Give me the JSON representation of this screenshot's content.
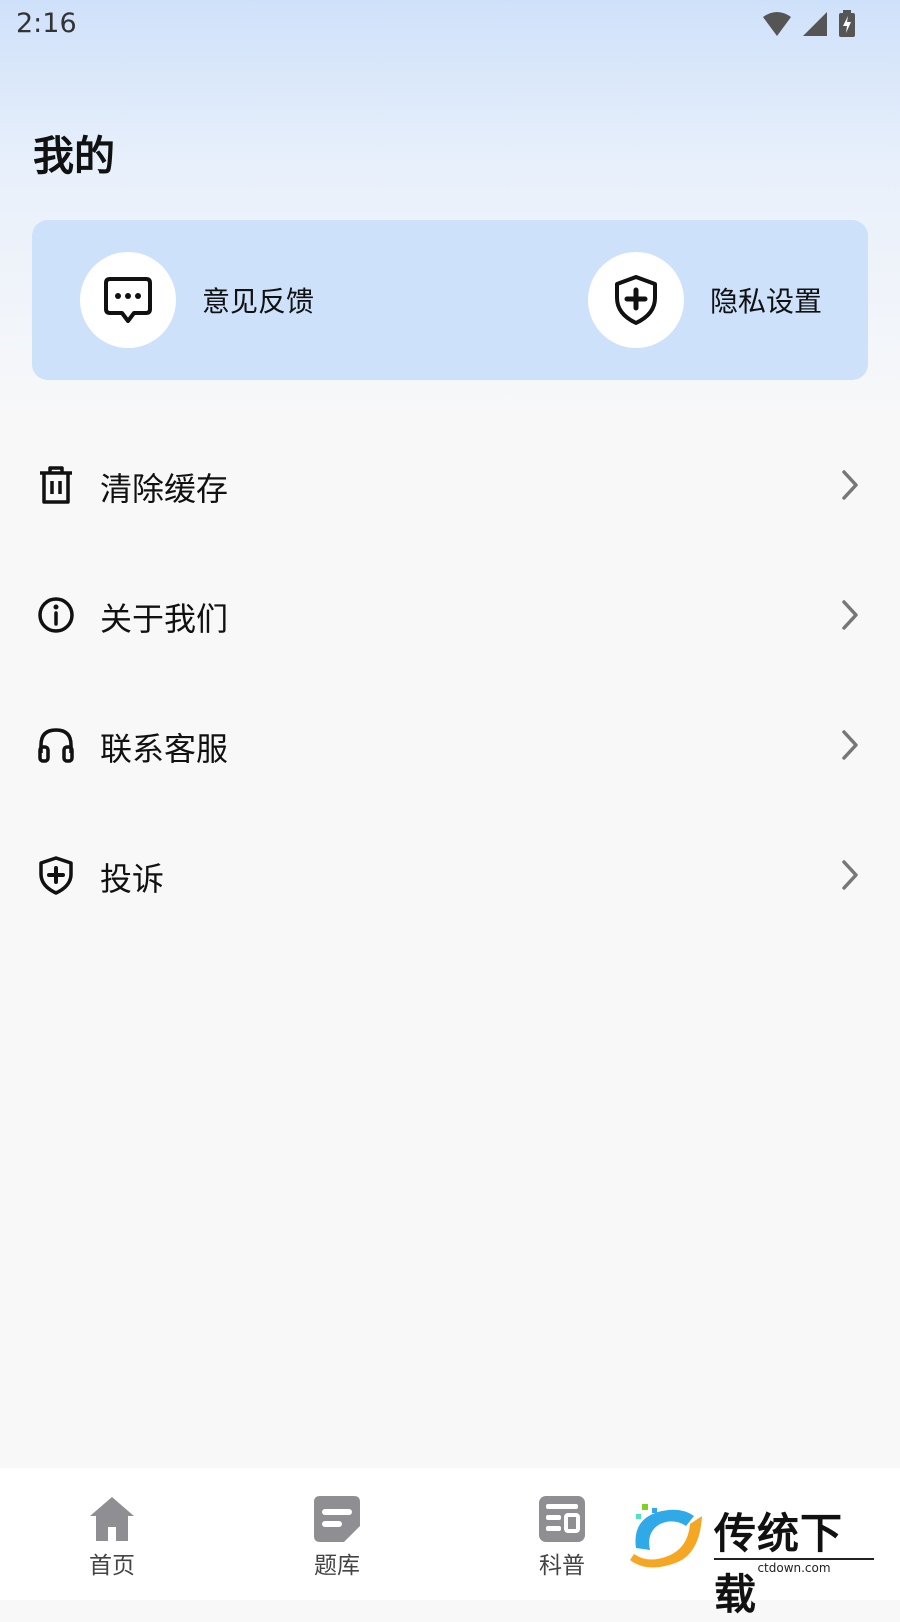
{
  "status_bar": {
    "time": "2:16",
    "icons": [
      "wifi-icon",
      "signal-icon",
      "battery-charging-icon"
    ]
  },
  "page": {
    "title": "我的"
  },
  "quick_actions": [
    {
      "label": "意见反馈",
      "icon": "message-icon"
    },
    {
      "label": "隐私设置",
      "icon": "shield-plus-icon"
    }
  ],
  "menu": [
    {
      "label": "清除缓存",
      "icon": "trash-icon"
    },
    {
      "label": "关于我们",
      "icon": "info-icon"
    },
    {
      "label": "联系客服",
      "icon": "headset-icon"
    },
    {
      "label": "投诉",
      "icon": "shield-plus-icon"
    }
  ],
  "bottom_nav": [
    {
      "label": "首页",
      "icon": "home-icon"
    },
    {
      "label": "题库",
      "icon": "question-bank-icon"
    },
    {
      "label": "科普",
      "icon": "news-icon"
    }
  ],
  "watermark": {
    "text": "传统下载",
    "sub": "ctdown.com"
  },
  "colors": {
    "card_bg": "#cde1fb",
    "header_gradient_top": "#cfe1fa",
    "page_bg": "#f8f8f9",
    "nav_icon": "#8e8e93"
  }
}
